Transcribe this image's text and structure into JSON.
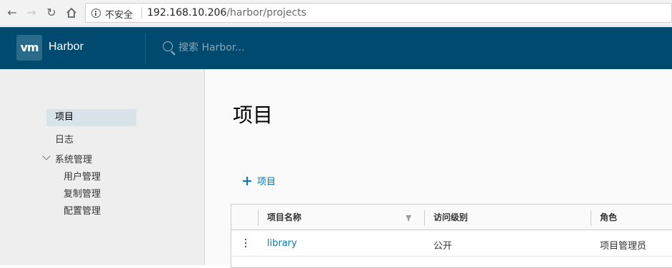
{
  "browser": {
    "security_label": "不安全",
    "url_host": "192.168.10.206",
    "url_path": "/harbor/projects"
  },
  "header": {
    "logo_text": "vm",
    "app_name": "Harbor",
    "search_placeholder": "搜索 Harbor..."
  },
  "sidebar": {
    "items": [
      {
        "label": "项目",
        "active": true
      },
      {
        "label": "日志"
      },
      {
        "label": "系统管理",
        "expanded": true,
        "children": [
          {
            "label": "用户管理"
          },
          {
            "label": "复制管理"
          },
          {
            "label": "配置管理"
          }
        ]
      }
    ]
  },
  "main": {
    "title": "项目",
    "add_button_label": "项目",
    "table": {
      "columns": [
        "项目名称",
        "访问级别",
        "角色"
      ],
      "rows": [
        {
          "name": "library",
          "access": "公开",
          "role": "项目管理员"
        }
      ]
    }
  }
}
